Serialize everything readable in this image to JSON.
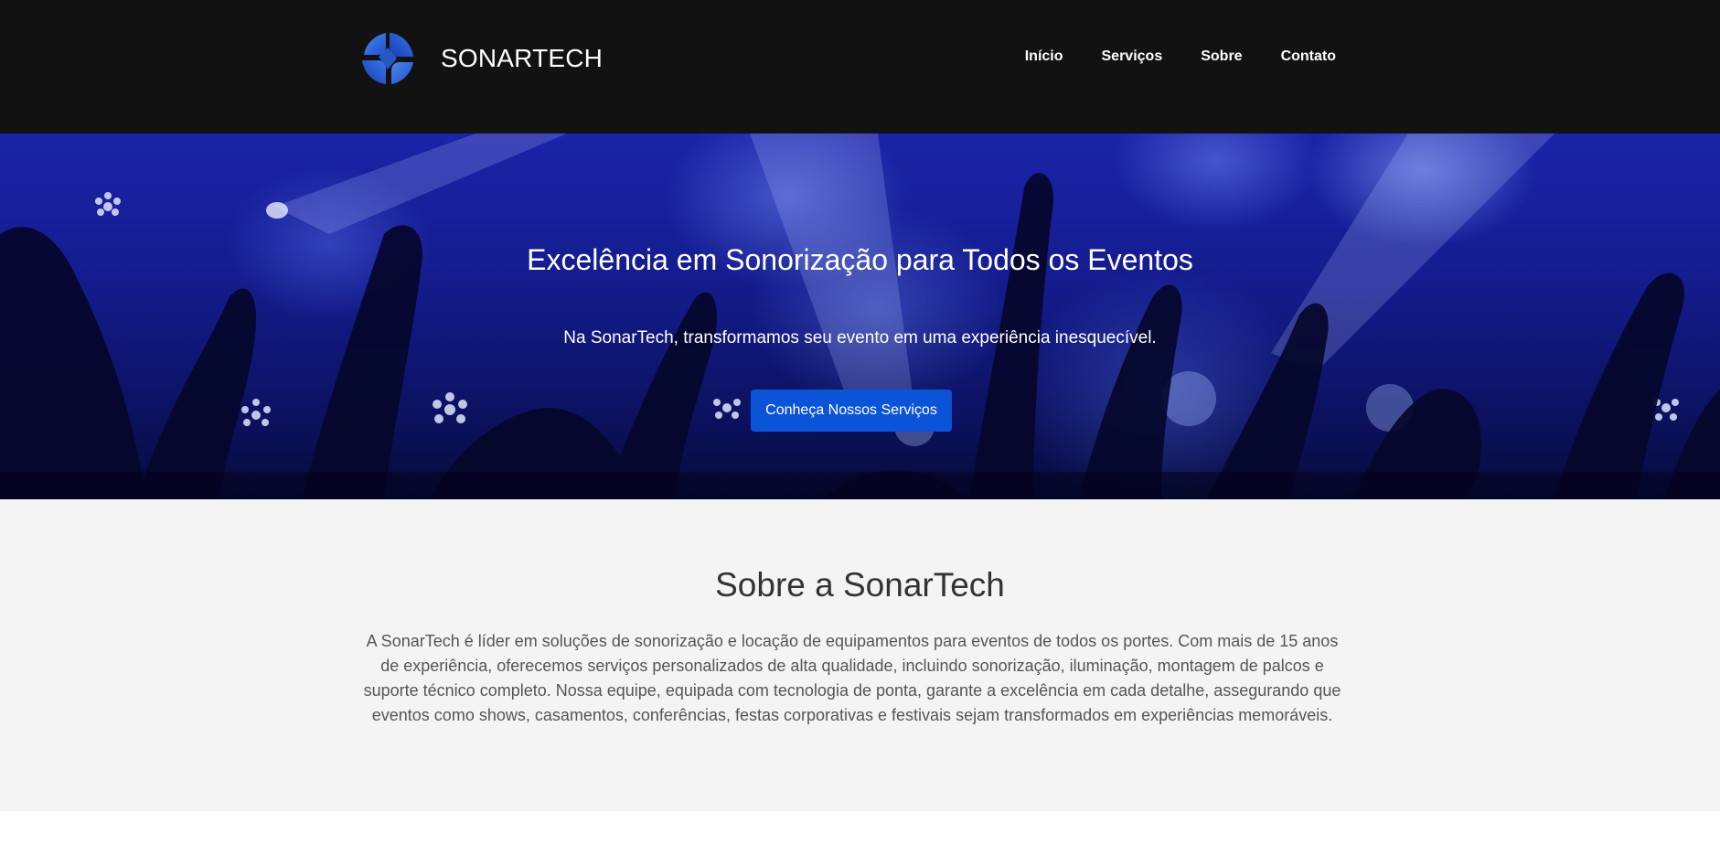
{
  "header": {
    "brand_name": "SONARTECH",
    "logo_icon": "sonartech-logo-icon",
    "nav": [
      {
        "label": "Início"
      },
      {
        "label": "Serviços"
      },
      {
        "label": "Sobre"
      },
      {
        "label": "Contato"
      }
    ]
  },
  "hero": {
    "title": "Excelência em Sonorização para Todos os Eventos",
    "subtitle": "Na SonarTech, transformamos seu evento em uma experiência inesquecível.",
    "cta_label": "Conheça Nossos Serviços",
    "background_image": "concert crowd with raised hands under blue stage lights"
  },
  "about": {
    "title": "Sobre a SonarTech",
    "text": "A SonarTech é líder em soluções de sonorização e locação de equipamentos para eventos de todos os portes. Com mais de 15 anos de experiência, oferecemos serviços personalizados de alta qualidade, incluindo sonorização, iluminação, montagem de palcos e suporte técnico completo. Nossa equipe, equipada com tecnologia de ponta, garante a excelência em cada detalhe, assegurando que eventos como shows, casamentos, conferências, festas corporativas e festivais sejam transformados em experiências memoráveis."
  },
  "colors": {
    "header_bg": "#121212",
    "accent": "#0c54d7",
    "about_bg": "#f4f4f4",
    "hero_blue": "#1b23a8"
  }
}
